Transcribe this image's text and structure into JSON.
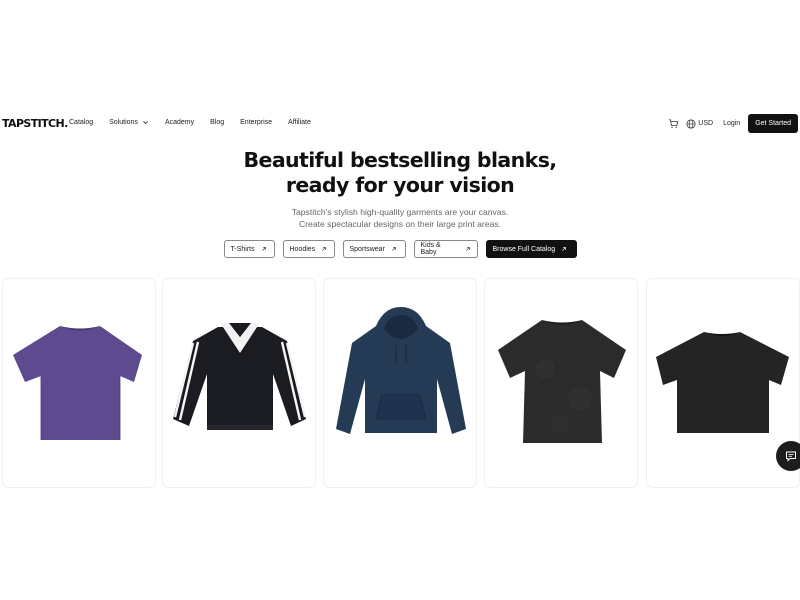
{
  "nav": {
    "logo": "TAPSTITCH.",
    "links": [
      "Catalog",
      "Solutions",
      "Academy",
      "Blog",
      "Enterprise",
      "Affiliate"
    ],
    "currency": "USD",
    "login": "Login",
    "cta": "Get Started"
  },
  "hero": {
    "title_line1": "Beautiful bestselling blanks,",
    "title_line2": "ready for your vision",
    "sub_line1": "Tapstitch's stylish high-quality garments are your canvas.",
    "sub_line2": "Create spectacular designs on their large print areas."
  },
  "categories": [
    "T-Shirts",
    "Hoodies",
    "Sportswear",
    "Kids & Baby",
    "Browse Full Catalog"
  ],
  "products": [
    {
      "name": "purple-tshirt",
      "color": "#5e4a8e"
    },
    {
      "name": "black-striped-polo-sweatshirt",
      "color": "#1b1c22"
    },
    {
      "name": "navy-hoodie",
      "color": "#243a55"
    },
    {
      "name": "black-acid-wash-tshirt",
      "color": "#2b2b2b"
    },
    {
      "name": "black-boxy-tshirt",
      "color": "#242424"
    }
  ]
}
